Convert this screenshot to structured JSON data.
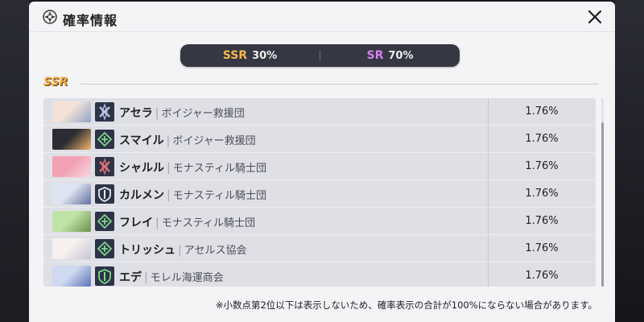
{
  "modal": {
    "title": "確率情報",
    "close_icon": "close-icon"
  },
  "rates": {
    "ssr_label": "SSR",
    "ssr_value": "30%",
    "sr_label": "SR",
    "sr_value": "70%",
    "ssr_color": "#f5b74a",
    "sr_color": "#d680f0"
  },
  "section": {
    "label": "SSR"
  },
  "rows": [
    {
      "name": "アセラ",
      "org": "ボイジャー救援団",
      "rate": "1.76%",
      "icon": "attacker-class-icon",
      "icon_color": "#b9c7e8",
      "portrait": [
        "#f4e2d8",
        "#8fa3c8"
      ]
    },
    {
      "name": "スマイル",
      "org": "ボイジャー救援団",
      "rate": "1.76%",
      "icon": "supporter-class-icon",
      "icon_color": "#7fd68a",
      "portrait": [
        "#2a2b33",
        "#f1b86a"
      ]
    },
    {
      "name": "シャルル",
      "org": "モナスティル騎士団",
      "rate": "1.76%",
      "icon": "attacker-class-icon",
      "icon_color": "#e0737a",
      "portrait": [
        "#f2a1b3",
        "#f7d6df"
      ]
    },
    {
      "name": "カルメン",
      "org": "モナスティル騎士団",
      "rate": "1.76%",
      "icon": "defender-class-icon",
      "icon_color": "#e9eaf0",
      "portrait": [
        "#dfe4f2",
        "#5d6f9e"
      ]
    },
    {
      "name": "フレイ",
      "org": "モナスティル騎士団",
      "rate": "1.76%",
      "icon": "supporter-class-icon",
      "icon_color": "#7fd68a",
      "portrait": [
        "#bfe3a6",
        "#6d8f4d"
      ]
    },
    {
      "name": "トリッシュ",
      "org": "アセルス協会",
      "rate": "1.76%",
      "icon": "supporter-class-icon",
      "icon_color": "#7fd68a",
      "portrait": [
        "#f6f1ee",
        "#c7c2d4"
      ]
    },
    {
      "name": "エデ",
      "org": "モレル海運商会",
      "rate": "1.76%",
      "icon": "defender-class-icon",
      "icon_color": "#7fd68a",
      "portrait": [
        "#cfd9f0",
        "#5b74b8"
      ]
    }
  ],
  "footnote": "※小数点第2位以下は表示しないため、確率表示の合計が100%にならない場合があります。"
}
